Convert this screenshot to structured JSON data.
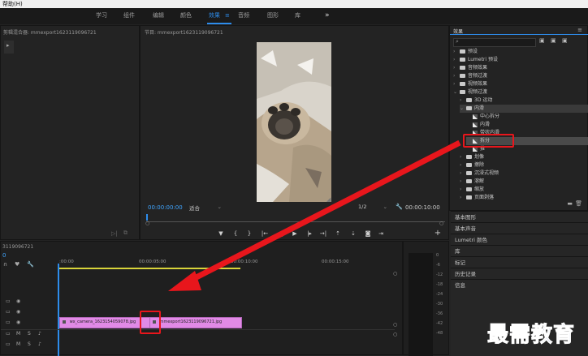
{
  "menu": {
    "help": "帮助(H)"
  },
  "workspaces": [
    "学习",
    "组件",
    "编辑",
    "颜色",
    "效果",
    "音频",
    "图形",
    "库"
  ],
  "workspace_active_index": 4,
  "workspace_more": "»",
  "source_panel": {
    "title": "剪辑混合器: mmexport1623119096721"
  },
  "program": {
    "title": "节目: mmexport1623119096721",
    "menu_icon": "≡",
    "timecode_left": "00:00:00:00",
    "fit": "适合",
    "resolution": "1/2",
    "timecode_right": "00:00:10:00"
  },
  "effects": {
    "title": "效果",
    "menu_icon": "≡",
    "search_placeholder": "",
    "tree": [
      {
        "label": "预设",
        "level": 0,
        "kind": "folder",
        "expanded": false
      },
      {
        "label": "Lumetri 预设",
        "level": 0,
        "kind": "folder",
        "expanded": false
      },
      {
        "label": "音频效果",
        "level": 0,
        "kind": "folder",
        "expanded": false
      },
      {
        "label": "音频过渡",
        "level": 0,
        "kind": "folder",
        "expanded": false
      },
      {
        "label": "视频效果",
        "level": 0,
        "kind": "folder",
        "expanded": false
      },
      {
        "label": "视频过渡",
        "level": 0,
        "kind": "folder",
        "expanded": true
      },
      {
        "label": "3D 运动",
        "level": 1,
        "kind": "folder",
        "expanded": false
      },
      {
        "label": "内滑",
        "level": 1,
        "kind": "folder",
        "expanded": true
      },
      {
        "label": "中心拆分",
        "level": 2,
        "kind": "effect"
      },
      {
        "label": "内滑",
        "level": 2,
        "kind": "effect"
      },
      {
        "label": "带状内滑",
        "level": 2,
        "kind": "effect"
      },
      {
        "label": "拆分",
        "level": 2,
        "kind": "effect",
        "selected": true
      },
      {
        "label": "推",
        "level": 2,
        "kind": "effect"
      },
      {
        "label": "划像",
        "level": 1,
        "kind": "folder",
        "expanded": false
      },
      {
        "label": "擦除",
        "level": 1,
        "kind": "folder",
        "expanded": false
      },
      {
        "label": "沉浸式视频",
        "level": 1,
        "kind": "folder",
        "expanded": false
      },
      {
        "label": "溶解",
        "level": 1,
        "kind": "folder",
        "expanded": false
      },
      {
        "label": "缩放",
        "level": 1,
        "kind": "folder",
        "expanded": false
      },
      {
        "label": "页面剥落",
        "level": 1,
        "kind": "folder",
        "expanded": false
      }
    ]
  },
  "side_panels": [
    "基本图形",
    "基本声音",
    "Lumetri 颜色",
    "库",
    "标记",
    "历史记录",
    "信息"
  ],
  "timeline": {
    "title": "3119096721",
    "playhead_time": "0",
    "ruler": [
      ":00:00",
      "00:00:05:00",
      "00:00:10:00",
      "00:00:15:00"
    ],
    "clips": [
      {
        "label": "wx_camera_1623154059078.jpg"
      },
      {
        "label": "mmexport1623119096721.jpg"
      }
    ],
    "track_labels": [
      "M",
      "S"
    ]
  },
  "meter_scale": [
    "0",
    "-6",
    "-12",
    "-18",
    "-24",
    "-30",
    "-36",
    "-42",
    "-48"
  ],
  "watermark": "最需教育",
  "colors": {
    "accent": "#2d8ceb",
    "annotation": "#e8161c",
    "clip": "#e18ae6",
    "watermark": "#1f3f9c"
  }
}
